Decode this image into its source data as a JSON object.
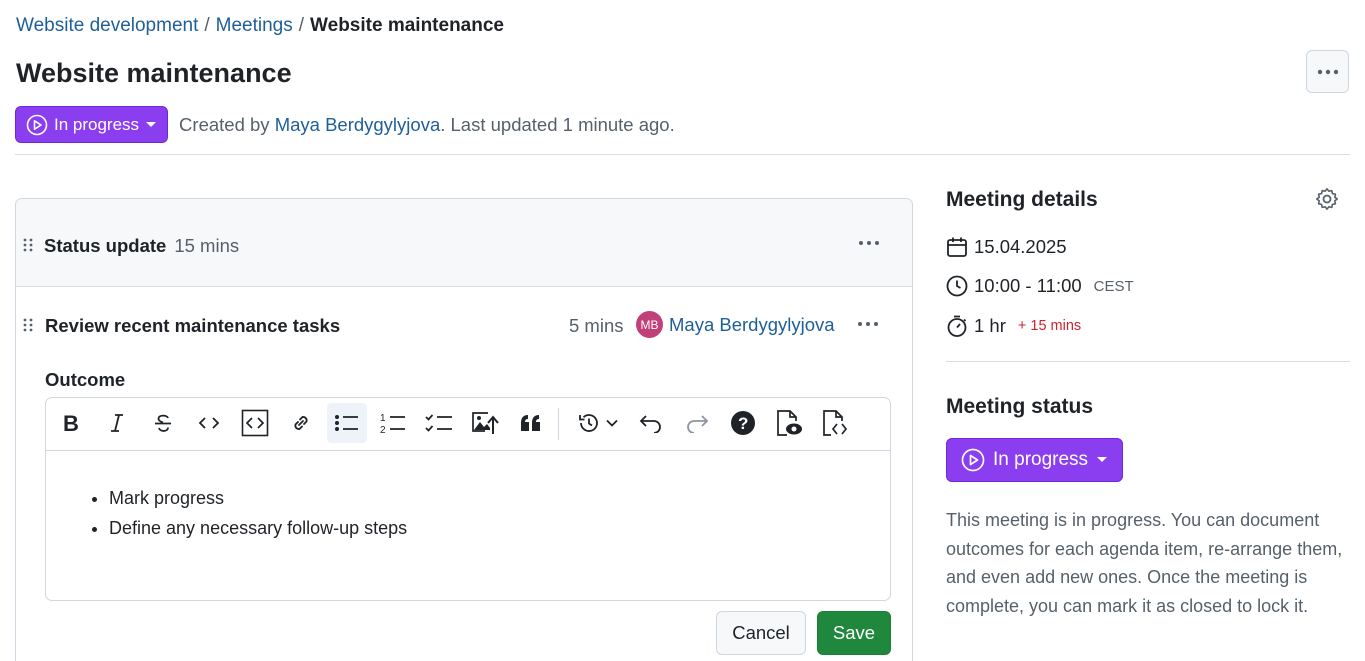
{
  "breadcrumb": {
    "project": "Website development",
    "meetings": "Meetings",
    "current": "Website maintenance",
    "separator": "/"
  },
  "page_title": "Website maintenance",
  "status": {
    "label": "In progress",
    "color": "#8b3ef0"
  },
  "meta": {
    "created_by_prefix": "Created by",
    "author": "Maya Berdygylyjova",
    "updated_text": ". Last updated 1 minute ago."
  },
  "agenda": {
    "section": {
      "title": "Status update",
      "duration": "15 mins"
    },
    "item": {
      "title": "Review recent maintenance tasks",
      "duration": "5 mins",
      "avatar_initials": "MB",
      "presenter": "Maya Berdygylyjova",
      "outcome_label": "Outcome",
      "bullets": [
        "Mark progress",
        "Define any necessary follow-up steps"
      ],
      "cancel_label": "Cancel",
      "save_label": "Save"
    },
    "toolbar_icons": [
      "bold-icon",
      "italic-icon",
      "strikethrough-icon",
      "code-icon",
      "code-block-icon",
      "link-icon",
      "bulleted-list-icon",
      "numbered-list-icon",
      "task-list-icon",
      "image-upload-icon",
      "quote-icon",
      "history-icon",
      "undo-icon",
      "redo-icon",
      "help-icon",
      "preview-icon",
      "source-icon"
    ]
  },
  "sidebar": {
    "details_title": "Meeting details",
    "date": "15.04.2025",
    "time": "10:00 - 11:00",
    "timezone": "CEST",
    "duration": "1 hr",
    "overrun": "+ 15 mins",
    "status_title": "Meeting status",
    "status_label": "In progress",
    "description": "This meeting is in progress. You can document outcomes for each agenda item, re-arrange them, and even add new ones. Once the meeting is complete, you can mark it as closed to lock it."
  },
  "colors": {
    "link": "#1f5f99",
    "status": "#8b3ef0",
    "save": "#1f883d",
    "overrun": "#cf222e"
  }
}
